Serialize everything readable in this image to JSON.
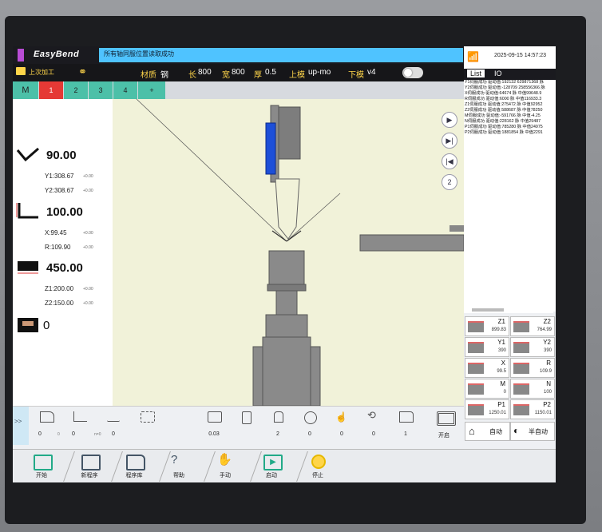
{
  "header": {
    "app_name": "EasyBend",
    "status_message": "所有轴同服位置读取成功"
  },
  "subheader": {
    "last_process_label": "上次加工",
    "material_label": "材质",
    "material_value": "钢",
    "length_label": "长",
    "length_value": "800",
    "width_label": "宽",
    "width_value": "800",
    "thickness_label": "厚",
    "thickness_value": "0.5",
    "upper_die_label": "上模",
    "upper_die_value": "up-mo",
    "lower_die_label": "下模",
    "lower_die_value": "v4"
  },
  "tabs": [
    "M",
    "1",
    "2",
    "3",
    "4",
    "+"
  ],
  "readouts": {
    "angle": "90.00",
    "y1": "Y1:308.67",
    "y1_off": "+0.00",
    "y2": "Y2:308.67",
    "y2_off": "+0.00",
    "flange": "100.00",
    "x": "X:99.45",
    "x_off": "+0.00",
    "r": "R:109.90",
    "r_off": "+0.00",
    "width": "450.00",
    "z1": "Z1:200.00",
    "z1_off": "+0.00",
    "z2": "Z2:150.00",
    "z2_off": "+0.00",
    "tool_count": "0"
  },
  "right_panel": {
    "datetime": "2025-09-15 14:57:23",
    "tab_list": "List",
    "tab_io": "IO",
    "list_items": [
      "Y1伺服成功 驱动值:192132 629871368 脉",
      "Y2伺服成功 驱动值:-128709 258556366 脉",
      "X伺服成功 驱动值:64674 脉 中值99648.9",
      "R伺服成功 驱动值:6000 脉 中值116933.3",
      "Z1伺服成功 驱动值:275472 脉 中值92952",
      "Z2伺服成功 驱动值:588687 脉 中值78250",
      "M伺服成功 驱动值:-591766 脉 中值-4.25",
      "N伺服成功 驱动值:228162 脉 中值29487",
      "P1伺服成功 驱动值:785280 脉 中值24975",
      "P2伺服成功 驱动值:1881854 脉 中值2291"
    ],
    "axes": [
      {
        "label": "Z1",
        "value": "899.83"
      },
      {
        "label": "Z2",
        "value": "764.99"
      },
      {
        "label": "Y1",
        "value": "390"
      },
      {
        "label": "Y2",
        "value": "390"
      },
      {
        "label": "X",
        "value": "99.5"
      },
      {
        "label": "R",
        "value": "109.9"
      },
      {
        "label": "M",
        "value": "0"
      },
      {
        "label": "N",
        "value": "100"
      },
      {
        "label": "P1",
        "value": "1250.01"
      },
      {
        "label": "P2",
        "value": "1150.01"
      }
    ],
    "auto_label": "自动",
    "semi_auto_label": "半自动"
  },
  "toolbar": {
    "values": [
      "0",
      "0",
      "0",
      "",
      "0.03",
      "2",
      "0",
      "0",
      "0",
      "1"
    ],
    "sub_values": [
      "0",
      "n=0"
    ],
    "open_label": "开启"
  },
  "bottom_bar": {
    "start": "开始",
    "new_program": "新程序",
    "program_lib": "程序库",
    "help": "帮助",
    "manual": "手动",
    "launch": "启动",
    "stop": "停止"
  },
  "canvas_controls": [
    "▶",
    "▶|",
    "|◀",
    "2"
  ],
  "colors": {
    "accent_purple": "#b84cd4",
    "status_blue": "#4fc3ff",
    "tab_teal": "#4cc0a8",
    "tab_active": "#e53935",
    "canvas_bg": "#f1f2d9",
    "punch_blue": "#1d4fd8"
  }
}
